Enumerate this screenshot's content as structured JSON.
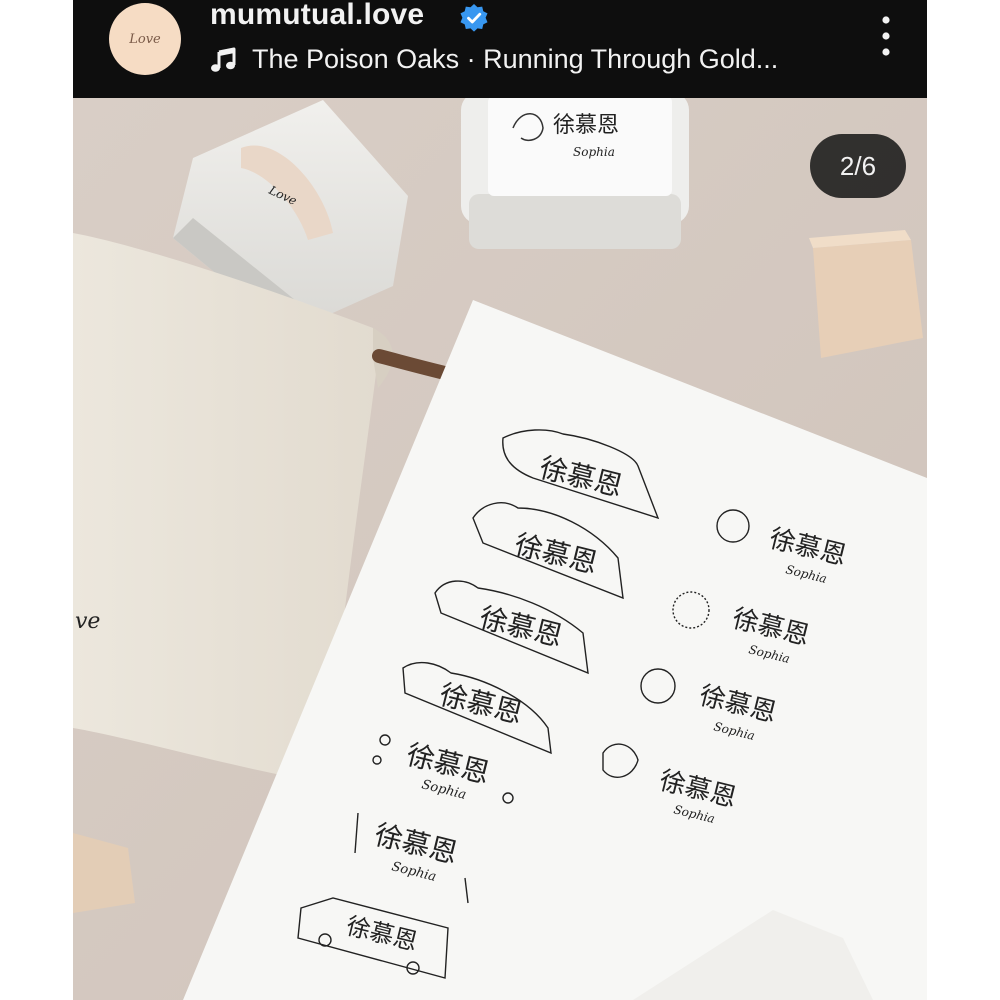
{
  "header": {
    "username": "mumutual.love",
    "song": "The Poison Oaks · Running Through Gold...",
    "avatar_text": "Love",
    "verified_icon": "verified-badge-icon",
    "music_icon": "music-note-icon",
    "more_icon": "more-vertical-icon"
  },
  "carousel": {
    "counter": "2/6"
  },
  "photo": {
    "box_text": "Love",
    "bag_text": "ve",
    "stamp_name": "徐慕恩",
    "stamp_sub": "Sophia"
  },
  "colors": {
    "header_bg": "#0e0e0e",
    "verified": "#3897f0",
    "table": "#d8ccc3"
  }
}
